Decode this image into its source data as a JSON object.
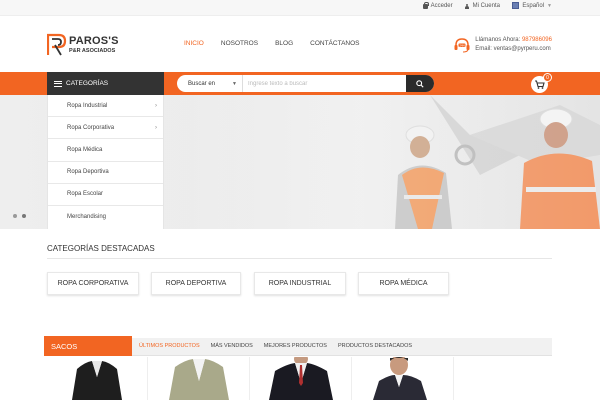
{
  "topbar": {
    "login": "Acceder",
    "account": "Mi Cuenta",
    "language": "Español"
  },
  "header": {
    "logo_name": "PAROS'S",
    "logo_sub": "P&R ASOCIADOS",
    "nav": [
      "INICIO",
      "NOSOTROS",
      "BLOG",
      "CONTÁCTANOS"
    ],
    "active_nav": "INICIO",
    "call_label": "Llámanos Ahora:",
    "phone": "987986096",
    "email": "Email: ventas@pyrperu.com"
  },
  "categories_bar": {
    "label": "CATEGORÍAS",
    "search_scope": "Buscar en",
    "search_placeholder": "Ingrese texto a buscar",
    "cart_count": "0"
  },
  "category_menu": [
    {
      "label": "Ropa Industrial",
      "has_sub": true
    },
    {
      "label": "Ropa Corporativa",
      "has_sub": true
    },
    {
      "label": "Ropa Médica",
      "has_sub": false
    },
    {
      "label": "Ropa Deportiva",
      "has_sub": false
    },
    {
      "label": "Ropa Escolar",
      "has_sub": false
    },
    {
      "label": "Merchandising",
      "has_sub": false
    }
  ],
  "featured": {
    "title": "CATEGORÍAS DESTACADAS",
    "items": [
      "ROPA CORPORATIVA",
      "ROPA DEPORTIVA",
      "ROPA INDUSTRIAL",
      "ROPA MÉDICA"
    ]
  },
  "products": {
    "section": "SACOS",
    "tabs": [
      "ÚLTIMOS PRODUCTOS",
      "MÁS VENDIDOS",
      "MEJORES PRODUCTOS",
      "PRODUCTOS DESTACADOS"
    ],
    "active_tab": "ÚLTIMOS PRODUCTOS"
  },
  "colors": {
    "accent": "#f26522",
    "dark": "#333333"
  },
  "icons": [
    "lock-icon",
    "user-icon",
    "flag-icon",
    "headset-icon",
    "menu-icon",
    "search-icon",
    "cart-icon",
    "chevron-right-icon"
  ]
}
